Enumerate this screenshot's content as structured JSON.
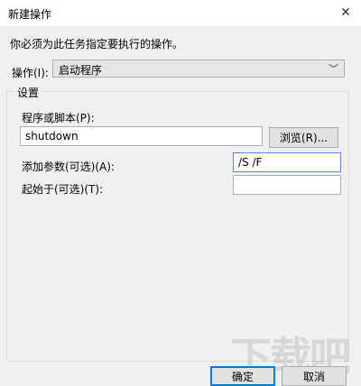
{
  "window": {
    "title": "新建操作"
  },
  "icons": {
    "close": "close-icon",
    "dropdown": "chevron-down-icon"
  },
  "instruction": "你必须为此任务指定要执行的操作。",
  "action": {
    "label": "操作(I):",
    "value": "启动程序"
  },
  "settings": {
    "group_label": "设置",
    "program": {
      "label": "程序或脚本(P):",
      "value": "shutdown",
      "browse_label": "浏览(R)..."
    },
    "arguments": {
      "label": "添加参数(可选)(A):",
      "value": "/S /F"
    },
    "start_in": {
      "label": "起始于(可选)(T):",
      "value": ""
    }
  },
  "buttons": {
    "ok": "确定",
    "cancel": "取消"
  },
  "watermark": "下载吧"
}
